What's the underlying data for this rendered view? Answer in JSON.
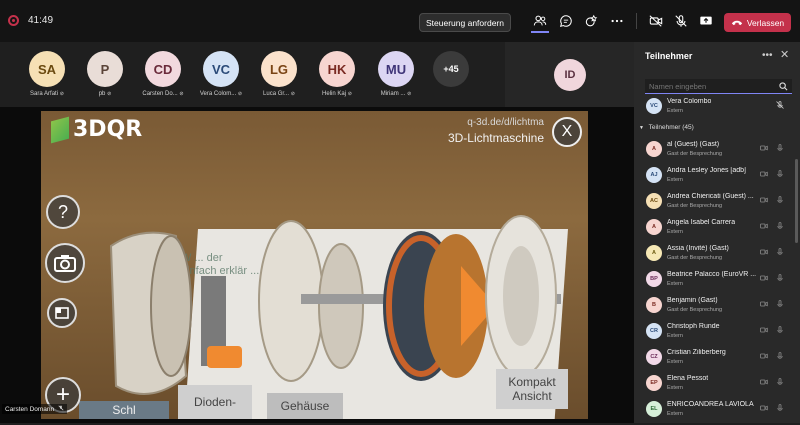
{
  "topbar": {
    "timer": "41:49",
    "request_control_label": "Steuerung anfordern",
    "leave_label": "Verlassen"
  },
  "participants_strip": [
    {
      "initials": "SA",
      "name": "Sara Arfati",
      "bg": "#f6e0b5",
      "fg": "#6b4a10"
    },
    {
      "initials": "P",
      "name": "pb",
      "bg": "#e9ddd7",
      "fg": "#5a4438"
    },
    {
      "initials": "CD",
      "name": "Carsten Do...",
      "bg": "#f2d9de",
      "fg": "#6a2a3a"
    },
    {
      "initials": "VC",
      "name": "Vera Colom...",
      "bg": "#d5e3f5",
      "fg": "#2a4a78"
    },
    {
      "initials": "LG",
      "name": "Luca Gr...",
      "bg": "#fbe2cc",
      "fg": "#7a4414"
    },
    {
      "initials": "HK",
      "name": "Helin Kaj",
      "bg": "#f7d5d0",
      "fg": "#7a2a22"
    },
    {
      "initials": "MU",
      "name": "Miriam ...",
      "bg": "#dcd6f3",
      "fg": "#3e3478"
    }
  ],
  "more_count": "+45",
  "id_tile": "ID",
  "video": {
    "logo": "3DQR",
    "url": "q-3d.de/d/lichtma",
    "title": "3D-Lichtmaschine",
    "close": "X",
    "poster_text": "W ... der\neinfach erklär ... ste",
    "labels": {
      "dioden": "Dioden-",
      "gehause": "Gehäuse",
      "kompakt": "Kompakt\nAnsicht",
      "left": "Schl"
    },
    "help": "?",
    "add": "+",
    "presenter": "Carsten Domann"
  },
  "panel": {
    "title": "Teilnehmer",
    "search_placeholder": "Namen eingeben",
    "pinned": {
      "initials": "VC",
      "name": "Vera Colombo",
      "sub": "Extern",
      "bg": "#d5e3f5",
      "fg": "#2a4a78"
    },
    "section": "Teilnehmer (45)",
    "rows": [
      {
        "initials": "A",
        "name": "al (Guest) (Gast)",
        "sub": "Gast der Besprechung",
        "bg": "#f7d5d0",
        "fg": "#7a2a22"
      },
      {
        "initials": "AJ",
        "name": "Andra Lesley Jones [adb]",
        "sub": "Extern",
        "bg": "#d5e3f5",
        "fg": "#2a4a78"
      },
      {
        "initials": "AC",
        "name": "Andrea Chiericati (Guest) ...",
        "sub": "Gast der Besprechung",
        "bg": "#f6e0b5",
        "fg": "#6b4a10"
      },
      {
        "initials": "A",
        "name": "Angela Isabel Carrera",
        "sub": "Extern",
        "bg": "#f7d5d0",
        "fg": "#7a2a22"
      },
      {
        "initials": "A",
        "name": "Assia (Invité) (Gast)",
        "sub": "Gast der Besprechung",
        "bg": "#f6e8b5",
        "fg": "#6b5a10"
      },
      {
        "initials": "BP",
        "name": "Beatrice Palacco (EuroVR ...",
        "sub": "Extern",
        "bg": "#f2d9e8",
        "fg": "#6a2a58"
      },
      {
        "initials": "B",
        "name": "Benjamin (Gast)",
        "sub": "Gast der Besprechung",
        "bg": "#f7d5d0",
        "fg": "#7a2a22"
      },
      {
        "initials": "CR",
        "name": "Christoph Runde",
        "sub": "Extern",
        "bg": "#d5e3f5",
        "fg": "#2a4a78"
      },
      {
        "initials": "CZ",
        "name": "Cristian Ziliberberg",
        "sub": "Extern",
        "bg": "#f2d9e8",
        "fg": "#6a2a58"
      },
      {
        "initials": "EP",
        "name": "Elena Pessot",
        "sub": "Extern",
        "bg": "#f7d5d0",
        "fg": "#7a2a22"
      },
      {
        "initials": "EL",
        "name": "ENRICOANDREA LAVIOLA",
        "sub": "Extern",
        "bg": "#d6efd9",
        "fg": "#2a6a34"
      }
    ]
  }
}
